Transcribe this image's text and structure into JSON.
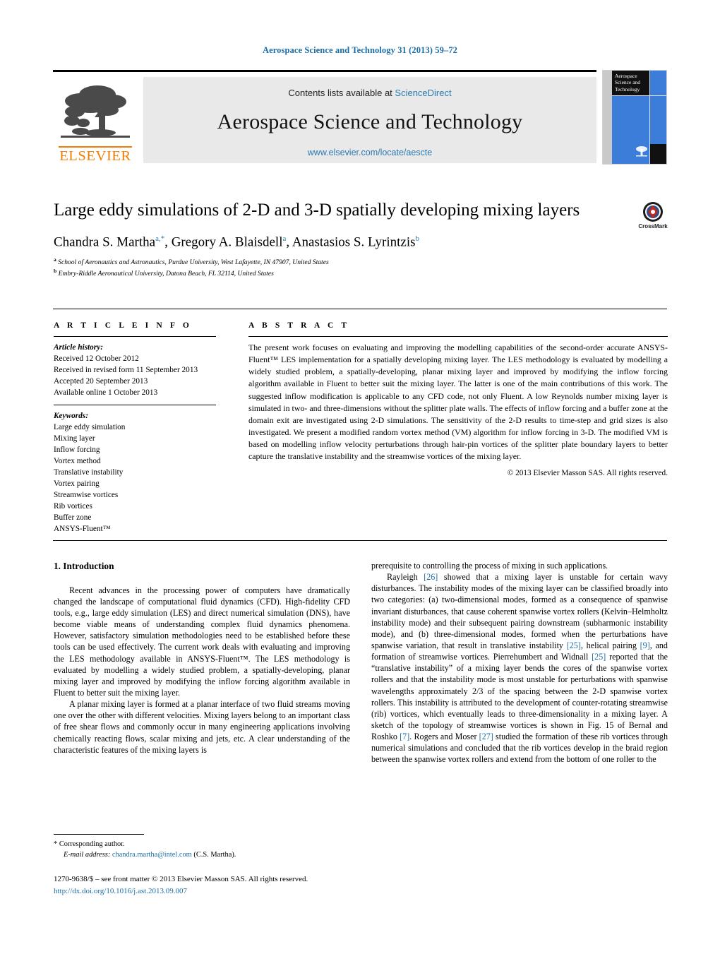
{
  "running_head": "Aerospace Science and Technology 31 (2013) 59–72",
  "masthead": {
    "contents_prefix": "Contents lists available at ",
    "sciencedirect": "ScienceDirect",
    "journal_title": "Aerospace Science and Technology",
    "journal_url": "www.elsevier.com/locate/aescte",
    "publisher_wordmark": "ELSEVIER",
    "cover_title": "Aerospace Science and Technology",
    "accent_link_color": "#2a7ab0",
    "elsevier_orange": "#f57c00",
    "cover_blue": "#3b7dd8"
  },
  "title": "Large eddy simulations of 2-D and 3-D spatially developing mixing layers",
  "authors": [
    {
      "name": "Chandra S. Martha",
      "marks": "a,*"
    },
    {
      "name": "Gregory A. Blaisdell",
      "marks": "a"
    },
    {
      "name": "Anastasios S. Lyrintzis",
      "marks": "b"
    }
  ],
  "affiliations": [
    {
      "mark": "a",
      "text": "School of Aeronautics and Astronautics, Purdue University, West Lafayette, IN 47907, United States"
    },
    {
      "mark": "b",
      "text": "Embry-Riddle Aeronautical University, Datona Beach, FL 32114, United States"
    }
  ],
  "crossmark": {
    "label": "CrossMark"
  },
  "article_info": {
    "heading": "A R T I C L E    I N F O",
    "history_label": "Article history:",
    "history": [
      "Received 12 October 2012",
      "Received in revised form 11 September 2013",
      "Accepted 20 September 2013",
      "Available online 1 October 2013"
    ],
    "keywords_label": "Keywords:",
    "keywords": [
      "Large eddy simulation",
      "Mixing layer",
      "Inflow forcing",
      "Vortex method",
      "Translative instability",
      "Vortex pairing",
      "Streamwise vortices",
      "Rib vortices",
      "Buffer zone",
      "ANSYS-Fluent™"
    ]
  },
  "abstract": {
    "heading": "A B S T R A C T",
    "text": "The present work focuses on evaluating and improving the modelling capabilities of the second-order accurate ANSYS-Fluent™ LES implementation for a spatially developing mixing layer. The LES methodology is evaluated by modelling a widely studied problem, a spatially-developing, planar mixing layer and improved by modifying the inflow forcing algorithm available in Fluent to better suit the mixing layer. The latter is one of the main contributions of this work. The suggested inflow modification is applicable to any CFD code, not only Fluent. A low Reynolds number mixing layer is simulated in two- and three-dimensions without the splitter plate walls. The effects of inflow forcing and a buffer zone at the domain exit are investigated using 2-D simulations. The sensitivity of the 2-D results to time-step and grid sizes is also investigated. We present a modified random vortex method (VM) algorithm for inflow forcing in 3-D. The modified VM is based on modelling inflow velocity perturbations through hair-pin vortices of the splitter plate boundary layers to better capture the translative instability and the streamwise vortices of the mixing layer.",
    "copyright": "© 2013 Elsevier Masson SAS. All rights reserved."
  },
  "body": {
    "section_heading": "1. Introduction",
    "left_paragraphs": [
      "Recent advances in the processing power of computers have dramatically changed the landscape of computational fluid dynamics (CFD). High-fidelity CFD tools, e.g., large eddy simulation (LES) and direct numerical simulation (DNS), have become viable means of understanding complex fluid dynamics phenomena. However, satisfactory simulation methodologies need to be established before these tools can be used effectively. The current work deals with evaluating and improving the LES methodology available in ANSYS-Fluent™. The LES methodology is evaluated by modelling a widely studied problem, a spatially-developing, planar mixing layer and improved by modifying the inflow forcing algorithm available in Fluent to better suit the mixing layer.",
      "A planar mixing layer is formed at a planar interface of two fluid streams moving one over the other with different velocities. Mixing layers belong to an important class of free shear flows and commonly occur in many engineering applications involving chemically reacting flows, scalar mixing and jets, etc. A clear understanding of the characteristic features of the mixing layers is"
    ],
    "right_paragraphs": [
      "prerequisite to controlling the process of mixing in such applications.",
      "Rayleigh [26] showed that a mixing layer is unstable for certain wavy disturbances. The instability modes of the mixing layer can be classified broadly into two categories: (a) two-dimensional modes, formed as a consequence of spanwise invariant disturbances, that cause coherent spanwise vortex rollers (Kelvin–Helmholtz instability mode) and their subsequent pairing downstream (subharmonic instability mode), and (b) three-dimensional modes, formed when the perturbations have spanwise variation, that result in translative instability [25], helical pairing [9], and formation of streamwise vortices. Pierrehumbert and Widnall [25] reported that the “translative instability” of a mixing layer bends the cores of the spanwise vortex rollers and that the instability mode is most unstable for perturbations with spanwise wavelengths approximately 2/3 of the spacing between the 2-D spanwise vortex rollers. This instability is attributed to the development of counter-rotating streamwise (rib) vortices, which eventually leads to three-dimensionality in a mixing layer. A sketch of the topology of streamwise vortices is shown in Fig. 15 of Bernal and Roshko [7]. Rogers and Moser [27] studied the formation of these rib vortices through numerical simulations and concluded that the rib vortices develop in the braid region between the spanwise vortex rollers and extend from the bottom of one roller to the"
    ]
  },
  "footnote": {
    "star": "*",
    "corresponding": "Corresponding author.",
    "email_label": "E-mail address:",
    "email": "chandra.martha@intel.com",
    "email_suffix": "(C.S. Martha)."
  },
  "footer": {
    "issn_line": "1270-9638/$ – see front matter © 2013 Elsevier Masson SAS. All rights reserved.",
    "doi": "http://dx.doi.org/10.1016/j.ast.2013.09.007"
  }
}
